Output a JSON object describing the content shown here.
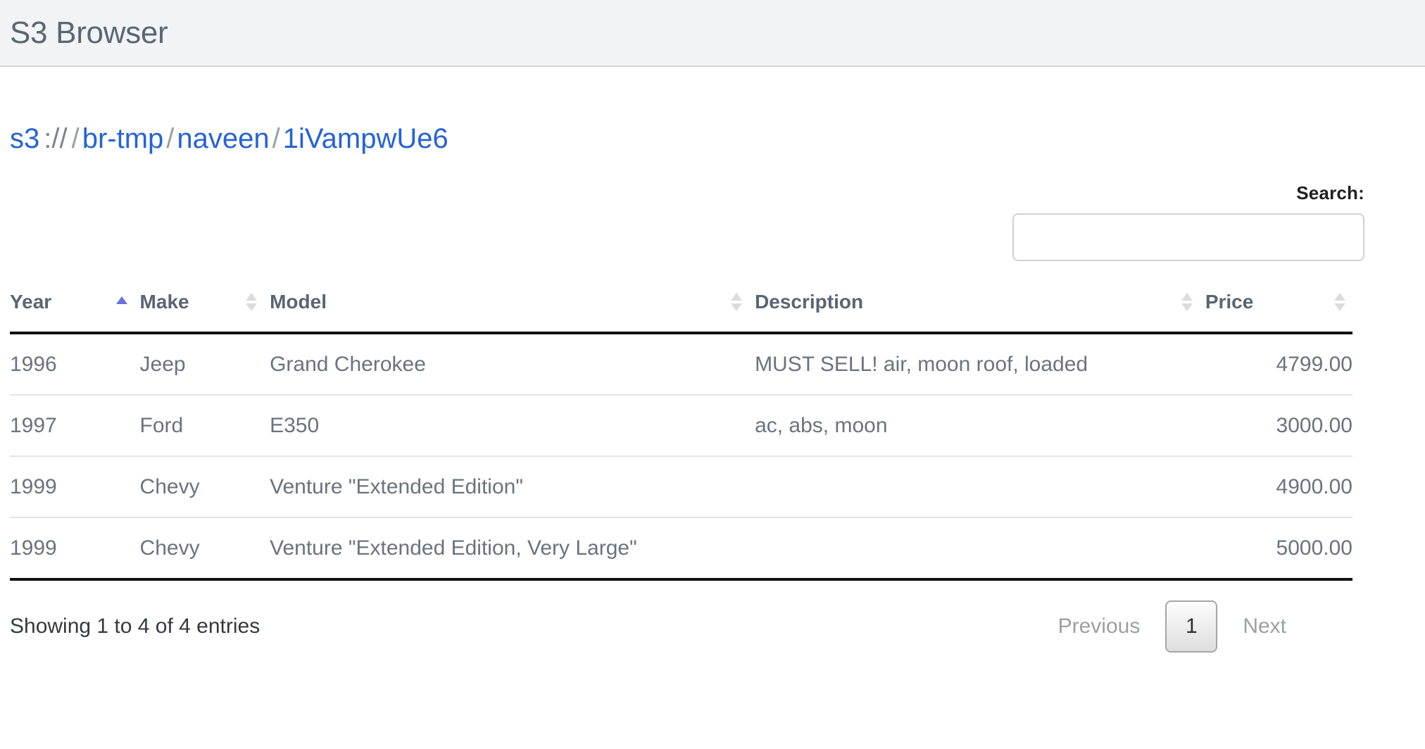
{
  "navbar": {
    "brand": "S3 Browser"
  },
  "breadcrumb": {
    "root": "s3",
    "scheme": "://",
    "separator": "/",
    "items": [
      {
        "label": "br-tmp"
      },
      {
        "label": "naveen"
      },
      {
        "label": "1iVampwUe6"
      }
    ]
  },
  "search": {
    "label": "Search:",
    "value": "",
    "placeholder": ""
  },
  "table": {
    "columns": [
      {
        "label": "Year",
        "sort": "asc",
        "align": "left"
      },
      {
        "label": "Make",
        "sort": "none",
        "align": "left"
      },
      {
        "label": "Model",
        "sort": "none",
        "align": "left"
      },
      {
        "label": "Description",
        "sort": "none",
        "align": "left"
      },
      {
        "label": "Price",
        "sort": "none",
        "align": "right"
      }
    ],
    "rows": [
      {
        "year": "1996",
        "make": "Jeep",
        "model": "Grand Cherokee",
        "description": "MUST SELL! air, moon roof, loaded",
        "price": "4799.00"
      },
      {
        "year": "1997",
        "make": "Ford",
        "model": "E350",
        "description": "ac, abs, moon",
        "price": "3000.00"
      },
      {
        "year": "1999",
        "make": "Chevy",
        "model": "Venture \"Extended Edition\"",
        "description": "",
        "price": "4900.00"
      },
      {
        "year": "1999",
        "make": "Chevy",
        "model": "Venture \"Extended Edition, Very Large\"",
        "description": "",
        "price": "5000.00"
      }
    ]
  },
  "footer": {
    "info": "Showing 1 to 4 of 4 entries",
    "pagination": {
      "previous": "Previous",
      "current_page": "1",
      "next": "Next"
    }
  },
  "colors": {
    "navbar_bg": "#f2f3f5",
    "brand_text": "#5a6673",
    "link": "#2563d6",
    "body_text": "#6a737d",
    "header_text": "#5a6573",
    "sort_active": "#6b72d6",
    "sort_inactive": "#dcdcdc",
    "rule_dark": "#111111",
    "rule_light": "#e3e4e6"
  }
}
